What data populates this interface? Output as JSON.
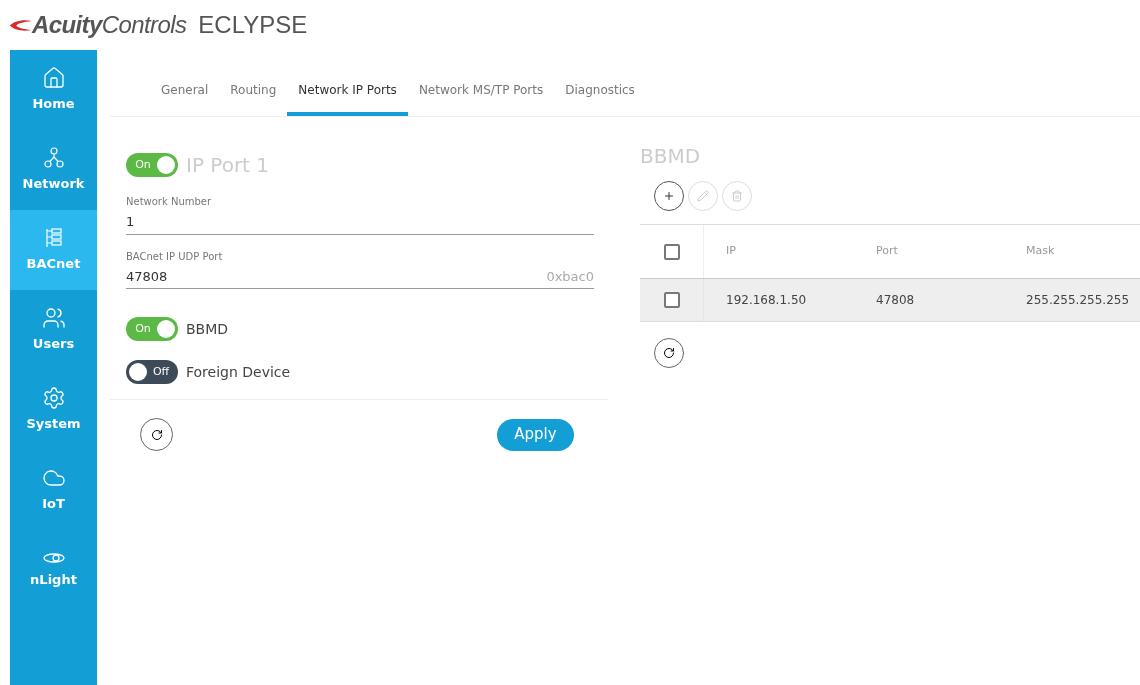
{
  "header": {
    "brand_bold": "Acuity",
    "brand_rest": "Controls",
    "product": "ECLYPSE"
  },
  "sidebar": {
    "items": [
      {
        "label": "Home",
        "selected": false
      },
      {
        "label": "Network",
        "selected": false
      },
      {
        "label": "BACnet",
        "selected": true
      },
      {
        "label": "Users",
        "selected": false
      },
      {
        "label": "System",
        "selected": false
      },
      {
        "label": "IoT",
        "selected": false
      },
      {
        "label": "nLight",
        "selected": false
      }
    ]
  },
  "tabs": [
    {
      "label": "General",
      "selected": false
    },
    {
      "label": "Routing",
      "selected": false
    },
    {
      "label": "Network IP Ports",
      "selected": true
    },
    {
      "label": "Network MS/TP Ports",
      "selected": false
    },
    {
      "label": "Diagnostics",
      "selected": false
    }
  ],
  "ip_port": {
    "toggle": {
      "label": "On",
      "on": true
    },
    "title": "IP Port 1",
    "fields": [
      {
        "label": "Network Number",
        "value": "1"
      },
      {
        "label": "BACnet IP UDP Port",
        "value": "47808",
        "suffix": "0xbac0"
      }
    ],
    "switches": [
      {
        "label": "BBMD",
        "state_label": "On",
        "on": true
      },
      {
        "label": "Foreign Device",
        "state_label": "Off",
        "on": false
      }
    ],
    "apply": "Apply"
  },
  "bbmd": {
    "title": "BBMD",
    "toolbar": [
      {
        "disabled": false
      },
      {
        "disabled": true
      },
      {
        "disabled": true
      }
    ],
    "table": {
      "header_checked": false,
      "columns": [
        "IP",
        "Port",
        "Mask"
      ],
      "rows": [
        {
          "checked": false,
          "highlighted": true,
          "cells": [
            "192.168.1.50",
            "47808",
            "255.255.255.255"
          ]
        }
      ]
    }
  }
}
